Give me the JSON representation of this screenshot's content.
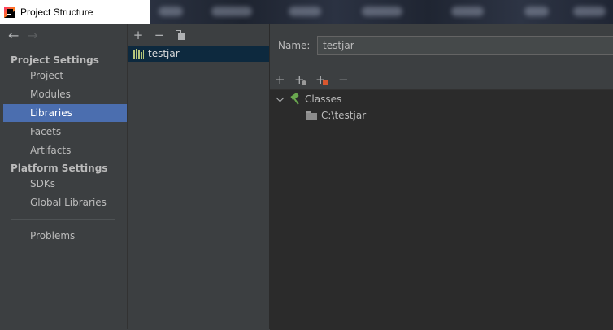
{
  "window": {
    "title": "Project Structure",
    "icon": "intellij-idea-icon"
  },
  "nav": {
    "back_icon": "back-arrow-icon",
    "forward_icon": "forward-arrow-icon",
    "sections": [
      {
        "header": "Project Settings",
        "items": [
          "Project",
          "Modules",
          "Libraries",
          "Facets",
          "Artifacts"
        ]
      },
      {
        "header": "Platform Settings",
        "items": [
          "SDKs",
          "Global Libraries"
        ]
      }
    ],
    "problems": "Problems",
    "selected": "Libraries"
  },
  "libraries_toolbar": {
    "add": "+",
    "remove": "−",
    "copy_icon": "copy-icon"
  },
  "libraries": [
    {
      "name": "testjar",
      "icon": "library-icon",
      "selected": true
    }
  ],
  "details": {
    "name_label": "Name:",
    "name_value": "testjar",
    "toolbar": {
      "add": "+",
      "add_alt": "+",
      "add_excluded": "+",
      "remove": "−"
    },
    "tree": {
      "root": {
        "label": "Classes",
        "icon": "hammer-icon",
        "expanded": true
      },
      "children": [
        {
          "label": "C:\\testjar",
          "icon": "folder-icon"
        }
      ]
    }
  }
}
